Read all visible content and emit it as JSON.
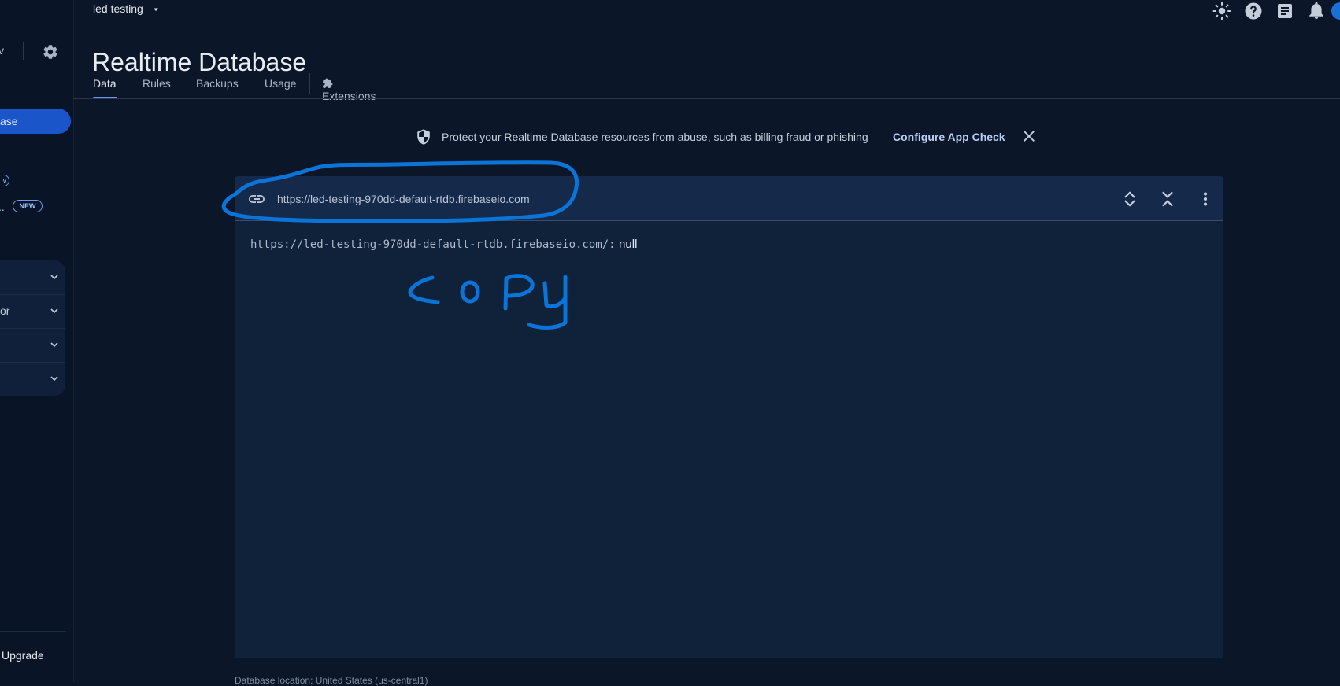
{
  "header": {
    "project_name": "led testing",
    "page_title": "Realtime Database",
    "tabs": [
      {
        "label": "Data"
      },
      {
        "label": "Rules"
      },
      {
        "label": "Backups"
      },
      {
        "label": "Usage"
      },
      {
        "label": "Extensions"
      }
    ],
    "active_tab": "Data"
  },
  "sidebar": {
    "top_text": "v",
    "active_item": "ase",
    "chip_label": "v",
    "truncated_label": "..",
    "new_badge": "NEW",
    "groups": [
      {
        "label": ""
      },
      {
        "label": "or"
      },
      {
        "label": ""
      },
      {
        "label": ""
      }
    ],
    "upgrade_label": "Upgrade"
  },
  "banner": {
    "text": "Protect your Realtime Database resources from abuse, such as billing fraud or phishing",
    "link": "Configure App Check"
  },
  "panel": {
    "url": "https://led-testing-970dd-default-rtdb.firebaseio.com",
    "tree_key": "https://led-testing-970dd-default-rtdb.firebaseio.com/:",
    "tree_value": "null"
  },
  "footer": {
    "location_stub": "Database location: United States (us-central1)"
  },
  "colors": {
    "accent": "#6d97ea",
    "annotation": "#0a74d8",
    "sidebar_active": "#1a56c9"
  }
}
